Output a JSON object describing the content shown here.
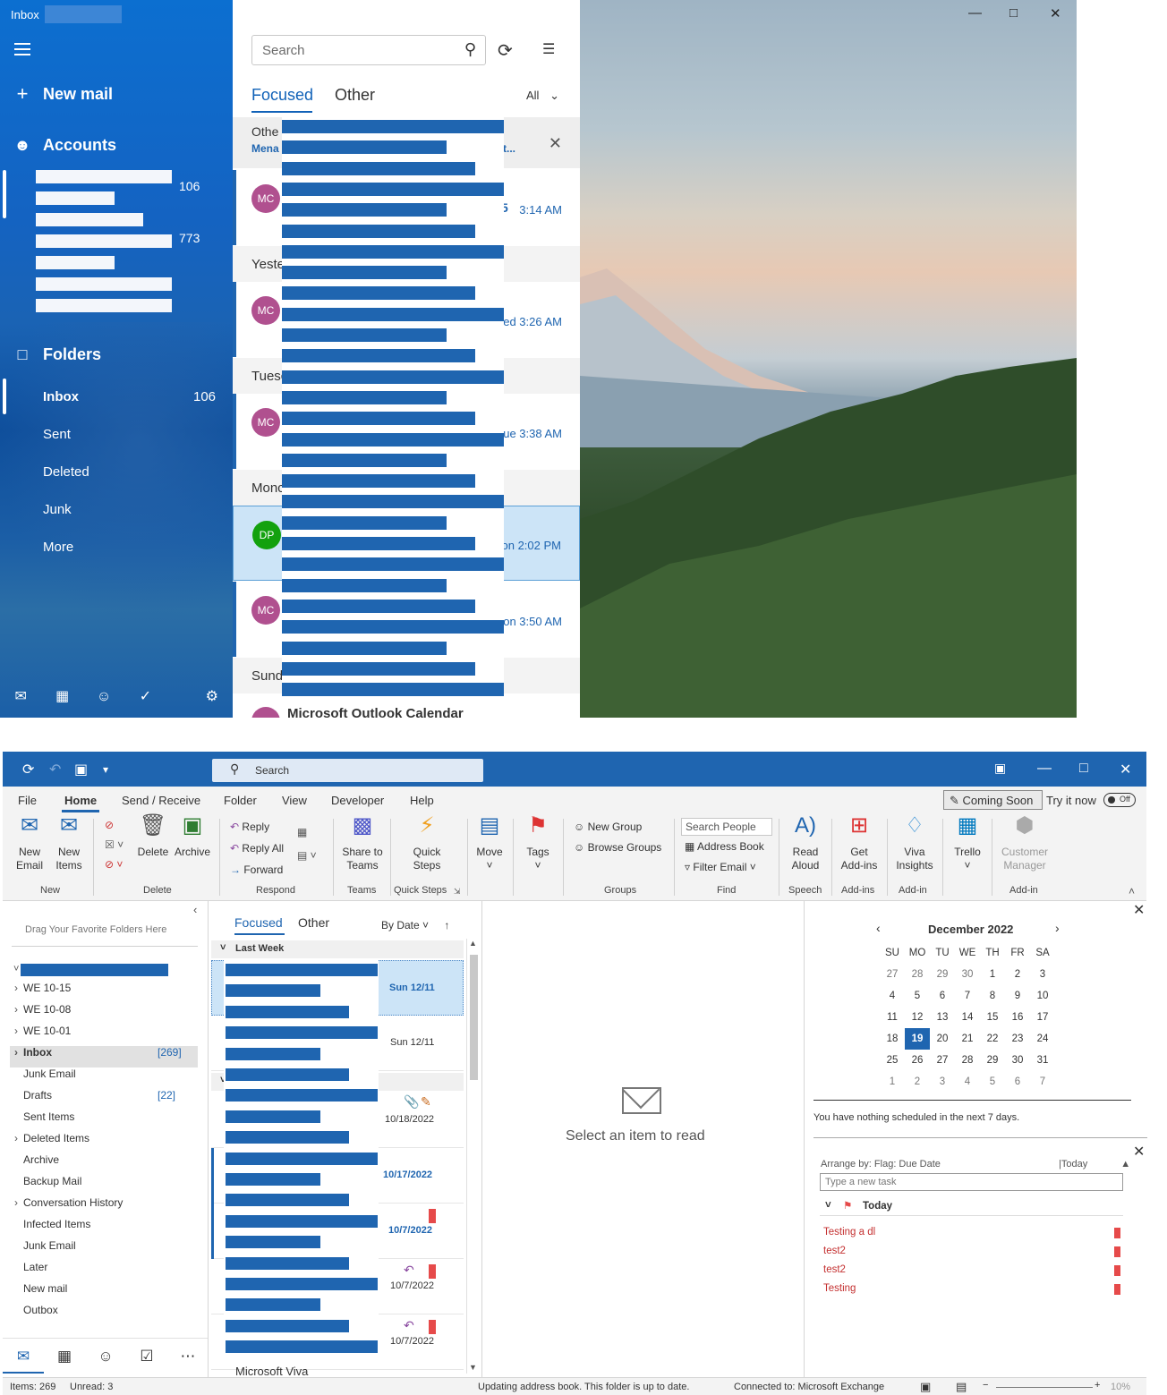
{
  "mail": {
    "title": "Inbox",
    "new_mail": "New mail",
    "accounts": "Accounts",
    "account_counts": [
      "106",
      "773"
    ],
    "folders_label": "Folders",
    "folders": [
      {
        "label": "Inbox",
        "count": "106"
      },
      {
        "label": "Sent",
        "count": ""
      },
      {
        "label": "Deleted",
        "count": ""
      },
      {
        "label": "Junk",
        "count": ""
      },
      {
        "label": "More",
        "count": ""
      }
    ],
    "search_placeholder": "Search",
    "tab_focused": "Focused",
    "tab_other": "Other",
    "filter_all": "All",
    "other_box": {
      "title": "Othe",
      "sub": "Mena",
      "trail": "t..."
    },
    "groups": [
      "Yeste",
      "Tuesc",
      "Monc",
      "Sund"
    ],
    "rows": [
      {
        "initials": "MC",
        "time": "3:14 AM",
        "extra": "5"
      },
      {
        "initials": "MC",
        "time": "ed 3:26 AM",
        "extra": ""
      },
      {
        "initials": "MC",
        "time": "ue 3:38 AM",
        "extra": ""
      },
      {
        "initials": "DP",
        "time": "on 2:02 PM",
        "extra": ""
      },
      {
        "initials": "MC",
        "time": "on 3:50 AM",
        "extra": ""
      }
    ],
    "last_sender": "Microsoft Outlook Calendar",
    "colors": {
      "accent": "#1f65b0",
      "mc": "#b0508f",
      "dp": "#13a10e"
    }
  },
  "outlook": {
    "search_placeholder": "Search",
    "menu": [
      "File",
      "Home",
      "Send / Receive",
      "Folder",
      "View",
      "Developer",
      "Help"
    ],
    "coming_soon": "Coming Soon",
    "try_it_now": "Try it now",
    "toggle": "Off",
    "ribbon": {
      "new_email": "New\nEmail",
      "new_items": "New\nItems",
      "delete": "Delete",
      "archive": "Archive",
      "reply": "Reply",
      "reply_all": "Reply All",
      "forward": "Forward",
      "share_teams": "Share to\nTeams",
      "quick_steps": "Quick\nSteps",
      "move": "Move",
      "tags": "Tags",
      "new_group": "New Group",
      "browse_groups": "Browse Groups",
      "search_people": "Search People",
      "address_book": "Address Book",
      "filter_email": "Filter Email",
      "read_aloud": "Read\nAloud",
      "get_addins": "Get\nAdd-ins",
      "viva": "Viva\nInsights",
      "trello": "Trello",
      "customer_manager": "Customer\nManager",
      "groups": [
        "New",
        "Delete",
        "Respond",
        "Teams",
        "Quick Steps",
        "Groups",
        "Find",
        "Speech",
        "Add-ins",
        "Add-in",
        "Add-in"
      ]
    },
    "folder_pane": {
      "fav_hint": "Drag Your Favorite Folders Here",
      "items": [
        {
          "label": "WE 10-15",
          "count": "",
          "chev": true
        },
        {
          "label": "WE 10-08",
          "count": "",
          "chev": true
        },
        {
          "label": "WE 10-01",
          "count": "",
          "chev": true
        },
        {
          "label": "Inbox",
          "count": "[269]",
          "chev": true
        },
        {
          "label": "Junk Email",
          "count": "",
          "chev": false
        },
        {
          "label": "Drafts",
          "count": "[22]",
          "chev": false
        },
        {
          "label": "Sent Items",
          "count": "",
          "chev": false
        },
        {
          "label": "Deleted Items",
          "count": "",
          "chev": true
        },
        {
          "label": "Archive",
          "count": "",
          "chev": false
        },
        {
          "label": "Backup Mail",
          "count": "",
          "chev": false
        },
        {
          "label": "Conversation History",
          "count": "",
          "chev": true
        },
        {
          "label": "Infected Items",
          "count": "",
          "chev": false
        },
        {
          "label": "Junk Email",
          "count": "",
          "chev": false
        },
        {
          "label": "Later",
          "count": "",
          "chev": false
        },
        {
          "label": "New mail",
          "count": "",
          "chev": false
        },
        {
          "label": "Outbox",
          "count": "",
          "chev": false
        }
      ]
    },
    "list": {
      "tab_focused": "Focused",
      "tab_other": "Other",
      "sort": "By Date",
      "group_last_week": "Last Week",
      "dates": [
        "Sun 12/11",
        "Sun 12/11",
        "10/18/2022",
        "10/17/2022",
        "10/7/2022",
        "10/7/2022",
        "10/7/2022"
      ],
      "last_sender": "Microsoft Viva"
    },
    "reading": {
      "empty": "Select an item to read"
    },
    "calendar": {
      "title": "December 2022",
      "days": [
        "SU",
        "MO",
        "TU",
        "WE",
        "TH",
        "FR",
        "SA"
      ],
      "weeks": [
        [
          "27",
          "28",
          "29",
          "30",
          "1",
          "2",
          "3"
        ],
        [
          "4",
          "5",
          "6",
          "7",
          "8",
          "9",
          "10"
        ],
        [
          "11",
          "12",
          "13",
          "14",
          "15",
          "16",
          "17"
        ],
        [
          "18",
          "19",
          "20",
          "21",
          "22",
          "23",
          "24"
        ],
        [
          "25",
          "26",
          "27",
          "28",
          "29",
          "30",
          "31"
        ],
        [
          "1",
          "2",
          "3",
          "4",
          "5",
          "6",
          "7"
        ]
      ],
      "today": "19",
      "nothing": "You have nothing scheduled in the next 7 days."
    },
    "tasks": {
      "arrange": "Arrange by: Flag: Due Date",
      "arrange_today": "Today",
      "placeholder": "Type a new task",
      "group": "Today",
      "items": [
        "Testing a dl",
        "test2",
        "test2",
        "Testing"
      ]
    },
    "status": {
      "items": "Items: 269",
      "unread": "Unread: 3",
      "updating": "Updating address book.  This folder is up to date.",
      "connected": "Connected to: Microsoft Exchange",
      "zoom": "10%"
    }
  }
}
